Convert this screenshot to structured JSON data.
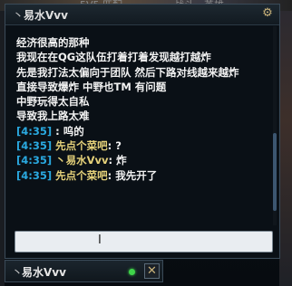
{
  "background": {
    "tabs": [
      "5V5 匹配",
      "战斗 - 英雄"
    ]
  },
  "chat": {
    "header": {
      "arrow": "丶",
      "name": "易水Vvv"
    },
    "icons": {
      "settings": "gear-icon",
      "close": "close-icon"
    },
    "lines": [
      "经济很高的那种",
      "我现在在QG这队伍打着打着发现越打越炸",
      "先是我打法太偏向于团队 然后下路对线越来越炸",
      "直接导致爆炸 中野也TM 有问题",
      "中野玩得太自私",
      "导致我上路太难"
    ],
    "messages": [
      {
        "time": "[4:35]",
        "sender": "",
        "text": "呜的"
      },
      {
        "time": "[4:35]",
        "sender": "先点个菜吧",
        "text": "?"
      },
      {
        "time": "[4:35]",
        "sender": "丶易水Vvv",
        "text": "炸"
      },
      {
        "time": "[4:35]",
        "sender": "先点个菜吧",
        "text": "我先开了"
      }
    ],
    "input": {
      "value": "",
      "placeholder": ""
    },
    "scroll": {
      "position_fraction": 0.7
    }
  },
  "bottom_tab": {
    "arrow": "丶",
    "name": "易水Vvv",
    "status": "online",
    "status_color": "#3fd44a",
    "close_label": "✕"
  },
  "colors": {
    "timestamp": "#2aa9e0",
    "sender": "#e6d27a",
    "text": "#f2f2f2",
    "online": "#3fd44a"
  }
}
